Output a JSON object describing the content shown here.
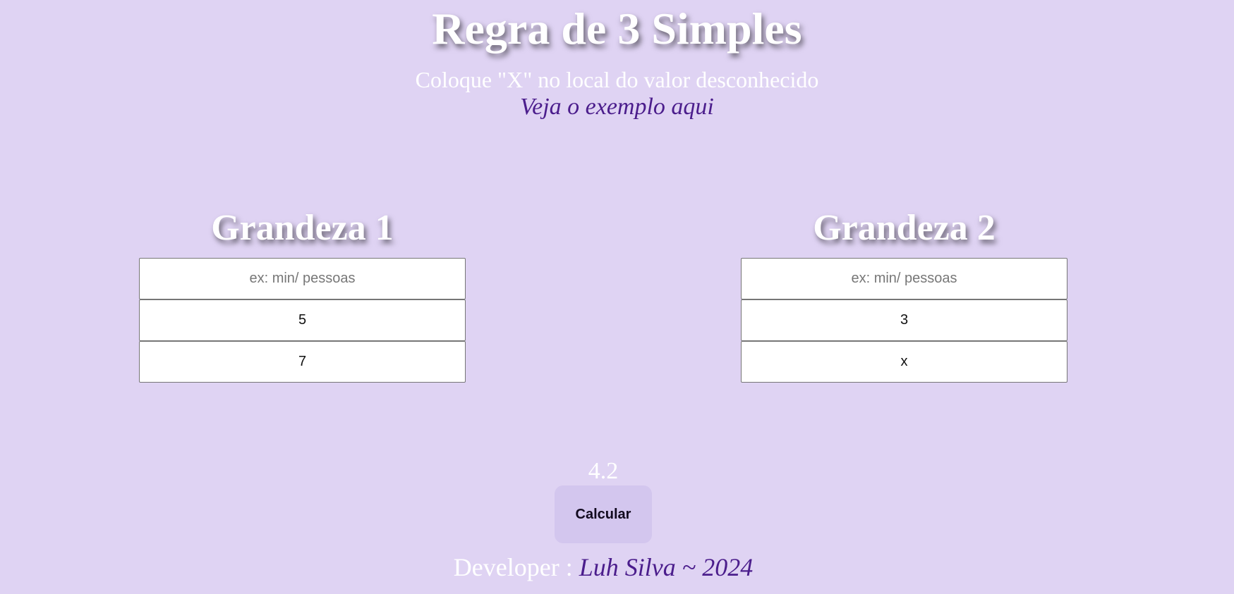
{
  "header": {
    "title": "Regra de 3 Simples",
    "subtitle": "Coloque \"X\" no local do valor desconhecido",
    "example_link": "Veja o exemplo aqui"
  },
  "grandeza1": {
    "heading": "Grandeza 1",
    "unit_placeholder": "ex: min/ pessoas",
    "unit_value": "",
    "value_a": "5",
    "value_b": "7"
  },
  "grandeza2": {
    "heading": "Grandeza 2",
    "unit_placeholder": "ex: min/ pessoas",
    "unit_value": "",
    "value_a": "3",
    "value_b": "x"
  },
  "result": {
    "value": "4.2"
  },
  "calculate_button": {
    "label": "Calcular"
  },
  "footer": {
    "prefix": "Developer : ",
    "author": "Luh Silva ~ 2024"
  },
  "colors": {
    "background": "#dfd3f3",
    "accent": "#4b1d8c",
    "button_background": "#d3c6ee",
    "heading_text": "#ffffff"
  }
}
